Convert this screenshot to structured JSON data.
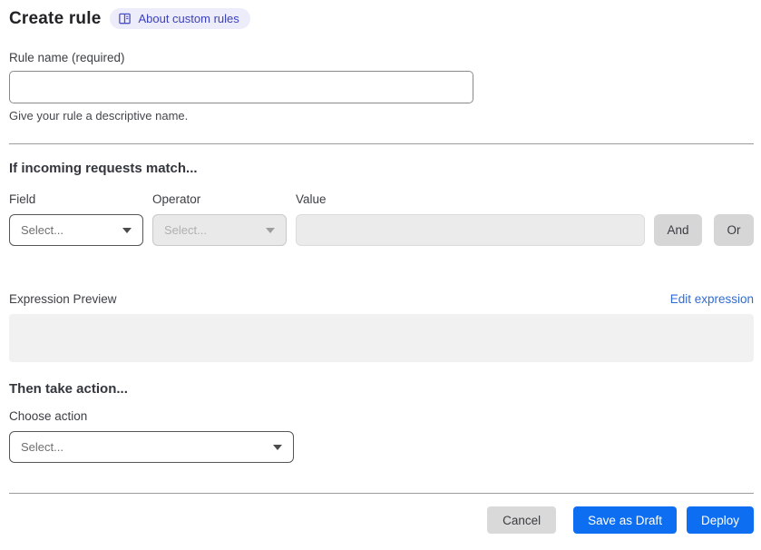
{
  "page": {
    "title": "Create rule",
    "about_badge_label": "About custom rules"
  },
  "rule_name": {
    "label": "Rule name (required)",
    "value": "",
    "helper": "Give your rule a descriptive name."
  },
  "match_section": {
    "heading": "If incoming requests match...",
    "field": {
      "label": "Field",
      "selected": "Select..."
    },
    "operator": {
      "label": "Operator",
      "selected": "Select..."
    },
    "value": {
      "label": "Value",
      "value": ""
    },
    "and_button": "And",
    "or_button": "Or",
    "expression_preview_label": "Expression Preview",
    "edit_expression_link": "Edit expression",
    "expression_value": ""
  },
  "action_section": {
    "heading": "Then take action...",
    "choose_action_label": "Choose action",
    "selected": "Select..."
  },
  "footer": {
    "cancel": "Cancel",
    "save_draft": "Save as Draft",
    "deploy": "Deploy"
  },
  "colors": {
    "primary_blue": "#0d6ef2",
    "link_blue": "#2f6bd3",
    "badge_bg": "#edecfa",
    "badge_text": "#3b41bd",
    "disabled_bg": "#e9e9e9",
    "gray_button_bg": "#d6d6d6",
    "preview_bg": "#f1f1f1"
  }
}
